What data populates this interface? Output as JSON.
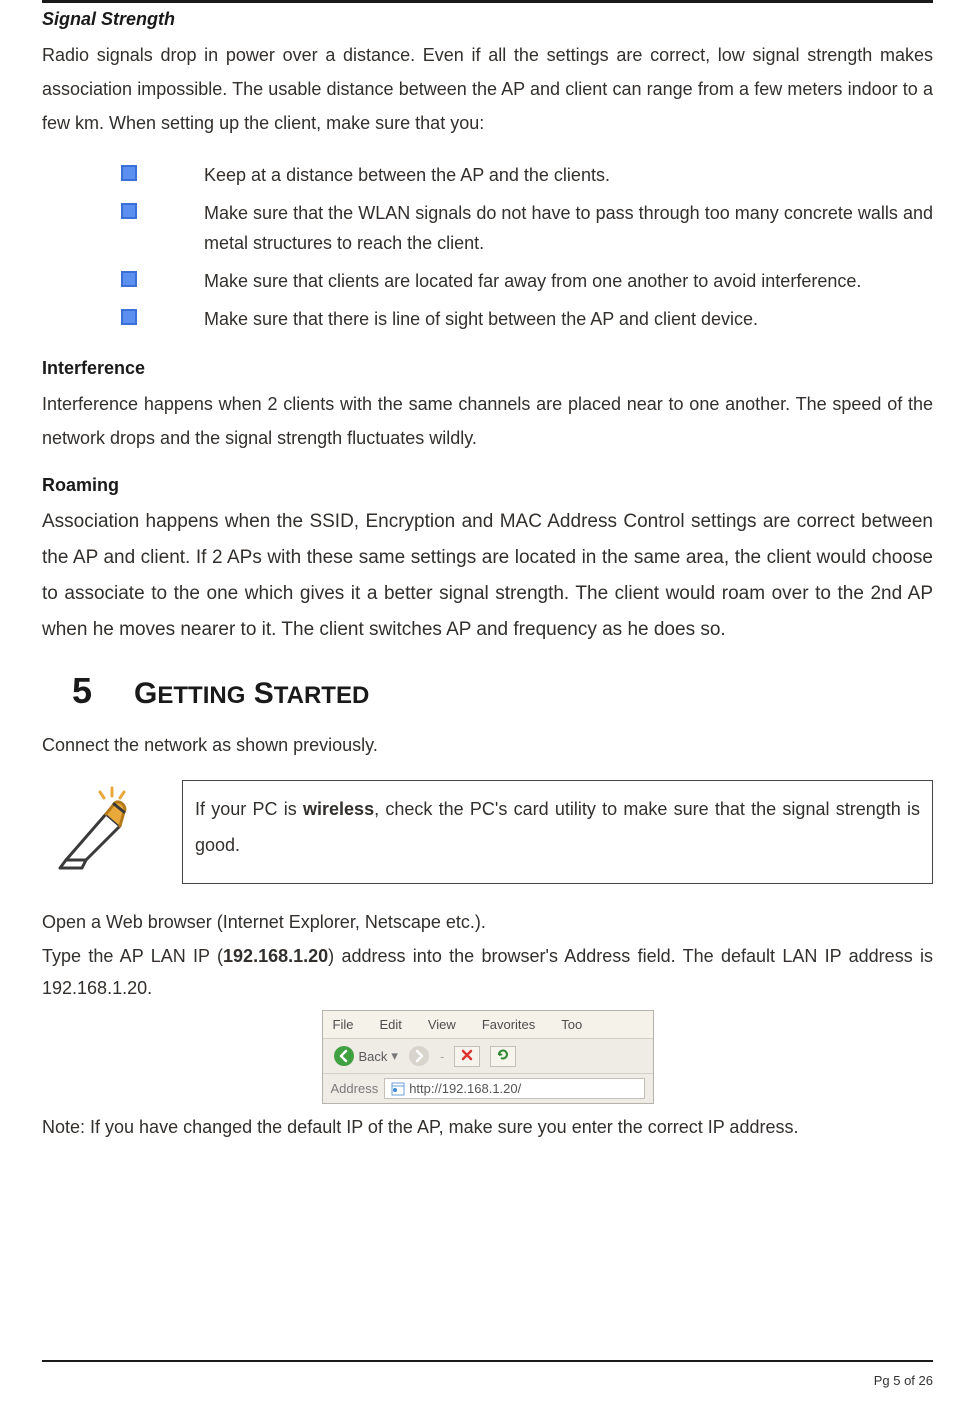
{
  "headings": {
    "signal_strength": "Signal Strength",
    "interference": "Interference",
    "roaming": "Roaming"
  },
  "paras": {
    "signal": "Radio signals drop in power over a distance. Even if all the settings are correct, low signal strength makes association impossible.  The usable distance between the AP and client can range from a few meters indoor to a few km. When setting up the client, make sure that you:",
    "interference": "Interference happens when 2 clients with the same channels are placed near to one another. The speed of the network drops and the signal strength fluctuates wildly.",
    "roaming": "Association happens when the SSID, Encryption and MAC Address Control settings are correct between the AP and client. If 2 APs with these same settings are located in the same area, the client would choose to associate to the one which gives it a better signal strength. The client would roam over to the 2nd AP when he moves nearer to it. The client switches AP and frequency as he does so.",
    "connect": "Connect the network as shown previously.",
    "open_browser": "Open a Web browser (Internet Explorer, Netscape etc.).",
    "type_ip_pre": "Type the AP LAN IP (",
    "type_ip_bold": "192.168.1.20",
    "type_ip_post": ") address into the browser's Address field. The default LAN IP address is 192.168.1.20.",
    "note_changed": "Note: If you have changed the default IP of the AP, make sure you enter the correct IP address."
  },
  "bullets": [
    "Keep at a distance between the AP and the clients.",
    "Make sure that the WLAN signals do not have to pass through too many concrete walls and metal structures to reach the client.",
    "Make sure that clients are located far away from one another to avoid interference.",
    "Make sure that there is line of sight between the AP and client device."
  ],
  "section5": {
    "num": "5",
    "t1": "G",
    "t2": "ETTING",
    "t3": " S",
    "t4": "TARTED"
  },
  "note": {
    "pre": "If your PC is ",
    "bold": "wireless",
    "post": ", check the PC's card utility to make sure that the signal strength is good."
  },
  "ie": {
    "menu": {
      "file": "File",
      "edit": "Edit",
      "view": "View",
      "fav": "Favorites",
      "too": "Too"
    },
    "back": "Back",
    "addr_label": "Address",
    "url": "http://192.168.1.20/"
  },
  "footer": "Pg 5 of 26"
}
